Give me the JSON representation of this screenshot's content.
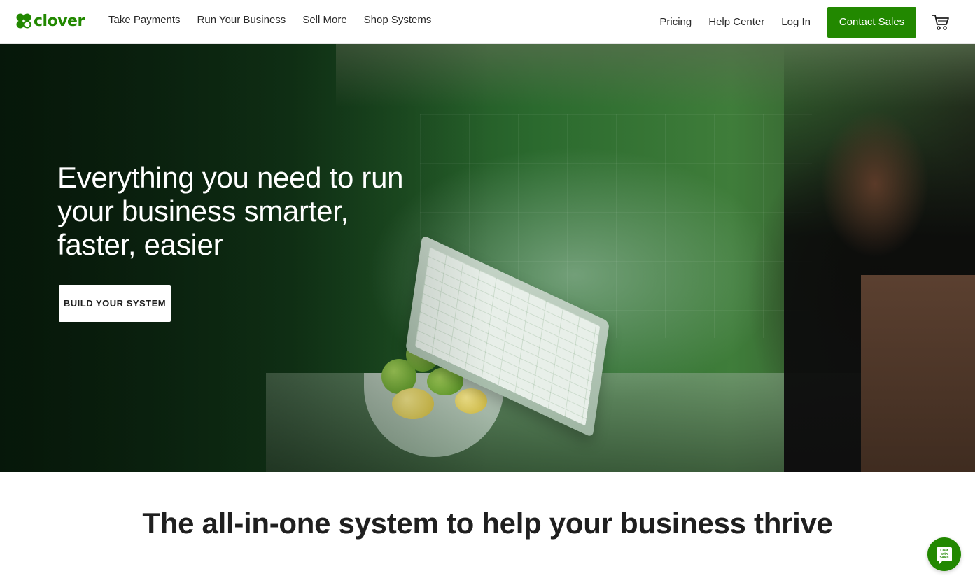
{
  "header": {
    "logo_text": "clover",
    "logo_icon": "clover-leaf-icon",
    "nav_left": [
      {
        "label": "Take Payments"
      },
      {
        "label": "Run Your Business"
      },
      {
        "label": "Sell More"
      },
      {
        "label": "Shop Systems"
      }
    ],
    "nav_right": [
      {
        "label": "Pricing"
      },
      {
        "label": "Help Center"
      },
      {
        "label": "Log In"
      }
    ],
    "contact_label": "Contact Sales",
    "cart_icon": "cart-icon"
  },
  "hero": {
    "title": "Everything you need to run your business smarter, faster, easier",
    "cta_label": "BUILD YOUR SYSTEM"
  },
  "section": {
    "title": "The all-in-one system to help your business thrive"
  },
  "chat": {
    "icon": "chat-icon",
    "label": "Chat\nwith\nSales"
  },
  "colors": {
    "brand_green": "#228800",
    "text": "#1f1f1f",
    "background": "#ffffff"
  }
}
